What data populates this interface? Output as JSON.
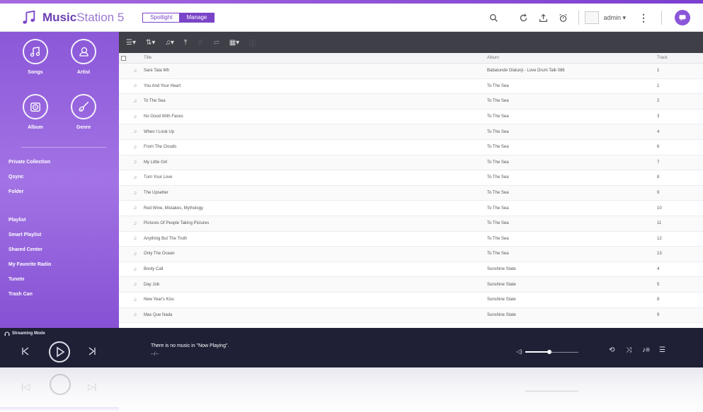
{
  "app": {
    "title_bold": "Music",
    "title_rest": "Station 5"
  },
  "mode_switch": {
    "spotlight": "Spotlight",
    "manage": "Manage"
  },
  "header": {
    "user": "admin ▾"
  },
  "sidebar": {
    "categories": [
      {
        "label": "Songs",
        "icon": "music-note-icon"
      },
      {
        "label": "Artist",
        "icon": "artist-icon"
      },
      {
        "label": "Album",
        "icon": "album-icon"
      },
      {
        "label": "Genre",
        "icon": "guitar-icon"
      }
    ],
    "sources": [
      "Private Collection",
      "Qsync",
      "Folder"
    ],
    "playlists": [
      "Playlist",
      "Smart Playlist",
      "Shared Center",
      "My Favorite Radio",
      "TuneIn",
      "Trash Can"
    ]
  },
  "table": {
    "headers": {
      "title": "Title",
      "album": "Album",
      "track": "Track"
    },
    "rows": [
      {
        "title": "Sare Tata Wh",
        "album": "Babatunde Olatunji - Love Drum Talk 086",
        "track": "1"
      },
      {
        "title": "You And Your Heart",
        "album": "To The Sea",
        "track": "1"
      },
      {
        "title": "To The Sea",
        "album": "To The Sea",
        "track": "2"
      },
      {
        "title": "No Good With Faces",
        "album": "To The Sea",
        "track": "3"
      },
      {
        "title": "When I Look Up",
        "album": "To The Sea",
        "track": "4"
      },
      {
        "title": "From The Clouds",
        "album": "To The Sea",
        "track": "6"
      },
      {
        "title": "My Little Girl",
        "album": "To The Sea",
        "track": "7"
      },
      {
        "title": "Turn Your Love",
        "album": "To The Sea",
        "track": "8"
      },
      {
        "title": "The Upsetter",
        "album": "To The Sea",
        "track": "9"
      },
      {
        "title": "Red Wine, Mistakes, Mythology",
        "album": "To The Sea",
        "track": "10"
      },
      {
        "title": "Pictures Of People Taking Pictures",
        "album": "To The Sea",
        "track": "11"
      },
      {
        "title": "Anything But The Truth",
        "album": "To The Sea",
        "track": "12"
      },
      {
        "title": "Only The Ocean",
        "album": "To The Sea",
        "track": "13"
      },
      {
        "title": "Booty Call",
        "album": "Sunshine State",
        "track": "4"
      },
      {
        "title": "Day Job",
        "album": "Sunshine State",
        "track": "5"
      },
      {
        "title": "New Year's Kiss",
        "album": "Sunshine State",
        "track": "8"
      },
      {
        "title": "Mas Que Nada",
        "album": "Sunshine State",
        "track": "9"
      }
    ]
  },
  "player": {
    "streaming_mode": "Streaming Mode",
    "now_playing_line1": "There is no music in \"Now Playing\".",
    "now_playing_line2": "--/--",
    "volume_percent": 45
  },
  "colors": {
    "accent": "#7c3fd0",
    "sidebar": "#9a68e0",
    "toolbar": "#3f3f47",
    "player": "#1f2036"
  }
}
